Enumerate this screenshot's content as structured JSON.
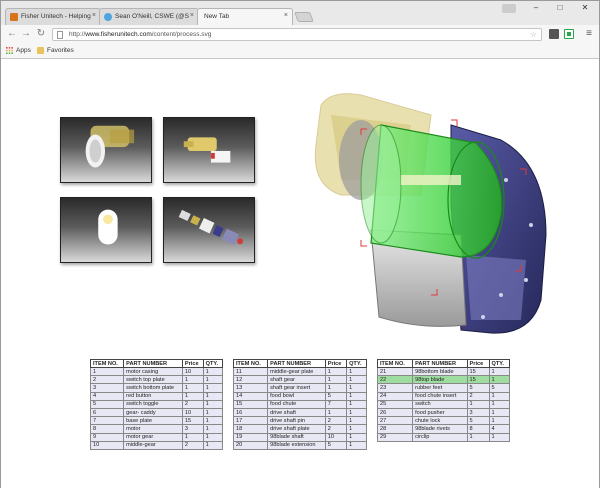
{
  "browser": {
    "tabs": [
      {
        "title": "Fisher Unitech - Helping",
        "icon": "fisher-favicon",
        "color": "#d8731c"
      },
      {
        "title": "Sean O'Neill, CSWE (@S",
        "icon": "twitter-favicon",
        "color": "#4fa3e0"
      },
      {
        "title": "New Tab",
        "icon": "",
        "color": ""
      }
    ],
    "profile_badge": "",
    "url_scheme": "http://",
    "url_domain": "www.fisherunitech.com",
    "url_path": "/content/process.svg",
    "bookmarks": [
      {
        "label": "Apps",
        "icon": "apps-grid-icon"
      },
      {
        "label": "Favorites",
        "icon": "folder-icon"
      }
    ]
  },
  "thumbnails": [
    {
      "name": "thumb-motor-assembly"
    },
    {
      "name": "thumb-switch-plate"
    },
    {
      "name": "thumb-gear-caddy"
    },
    {
      "name": "thumb-exploded-view"
    }
  ],
  "parts_headers": [
    "ITEM NO.",
    "PART NUMBER",
    "Price",
    "QTY."
  ],
  "parts_tables": [
    {
      "rows": [
        [
          "1",
          "motor casing",
          "10",
          "1"
        ],
        [
          "2",
          "switch top plate",
          "1",
          "1"
        ],
        [
          "3",
          "switch bottom plate",
          "1",
          "1"
        ],
        [
          "4",
          "red button",
          "1",
          "1"
        ],
        [
          "5",
          "switch toggle",
          "2",
          "1"
        ],
        [
          "6",
          "gear- caddy",
          "10",
          "1"
        ],
        [
          "7",
          "base plate",
          "15",
          "1"
        ],
        [
          "8",
          "motor",
          "3",
          "1"
        ],
        [
          "9",
          "motor gear",
          "1",
          "1"
        ],
        [
          "10",
          "middle-gear",
          "2",
          "1"
        ]
      ]
    },
    {
      "rows": [
        [
          "11",
          "middle-gear plate",
          "1",
          "1"
        ],
        [
          "12",
          "shaft gear",
          "1",
          "1"
        ],
        [
          "13",
          "shaft gear insert",
          "1",
          "1"
        ],
        [
          "14",
          "food bowl",
          "5",
          "1"
        ],
        [
          "15",
          "food chute",
          "7",
          "1"
        ],
        [
          "16",
          "drive shaft",
          "1",
          "1"
        ],
        [
          "17",
          "drive shaft pin",
          "2",
          "1"
        ],
        [
          "18",
          "drive shaft plate",
          "2",
          "1"
        ],
        [
          "19",
          "98blade shaft",
          "10",
          "1"
        ],
        [
          "20",
          "98blade extension",
          "5",
          "1"
        ]
      ]
    },
    {
      "highlight_row": 1,
      "highlight_color": "#9fdc9f",
      "rows": [
        [
          "21",
          "98bottom blade",
          "15",
          "1"
        ],
        [
          "22",
          "98top blade",
          "15",
          "1"
        ],
        [
          "23",
          "rubber feet",
          "5",
          "5"
        ],
        [
          "24",
          "food chute insert",
          "2",
          "1"
        ],
        [
          "25",
          "switch",
          "1",
          "1"
        ],
        [
          "26",
          "food pusher",
          "3",
          "1"
        ],
        [
          "27",
          "chute lock",
          "5",
          "1"
        ],
        [
          "28",
          "98blade rivets",
          "8",
          "4"
        ],
        [
          "29",
          "circlip",
          "1",
          "1"
        ]
      ]
    }
  ],
  "colors": {
    "selected_part": "#3fd33f",
    "casing": "#3b3d8c",
    "transparent_yellow": "#d8c870"
  }
}
